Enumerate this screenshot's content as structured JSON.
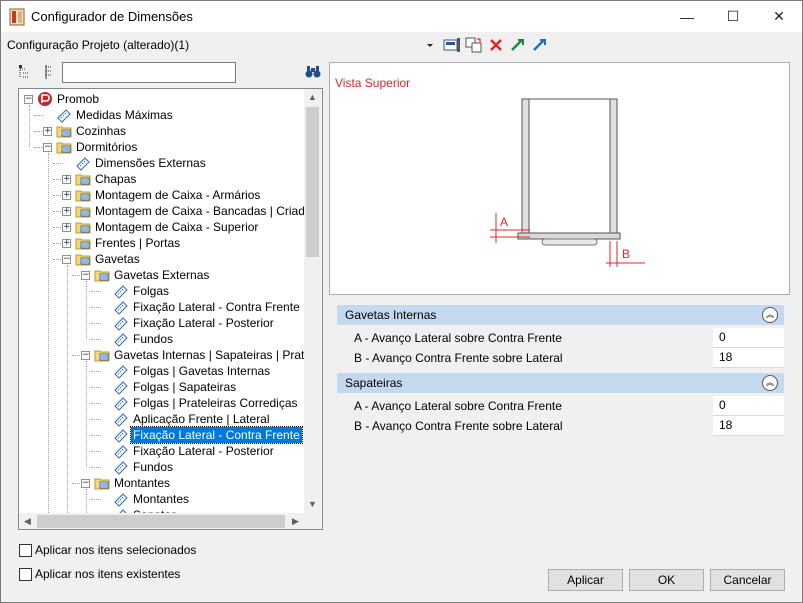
{
  "window": {
    "title": "Configurador de Dimensões",
    "minimize": "—",
    "maximize": "☐",
    "close": "✕"
  },
  "config_label": "Configuração Projeto (alterado)(1)",
  "search": {
    "value": "",
    "placeholder": ""
  },
  "tree": [
    {
      "label": "Promob",
      "selected": false
    },
    {
      "label": "Medidas Máximas",
      "selected": false
    },
    {
      "label": "Cozinhas",
      "selected": false
    },
    {
      "label": "Dormitórios",
      "selected": false
    },
    {
      "label": "Dimensões Externas",
      "selected": false
    },
    {
      "label": "Chapas",
      "selected": false
    },
    {
      "label": "Montagem de Caixa - Armários",
      "selected": false
    },
    {
      "label": "Montagem de Caixa - Bancadas | Criados",
      "selected": false
    },
    {
      "label": "Montagem de Caixa - Superior",
      "selected": false
    },
    {
      "label": "Frentes | Portas",
      "selected": false
    },
    {
      "label": "Gavetas",
      "selected": false
    },
    {
      "label": "Gavetas Externas",
      "selected": false
    },
    {
      "label": "Folgas",
      "selected": false
    },
    {
      "label": "Fixação Lateral - Contra Frente",
      "selected": false
    },
    {
      "label": "Fixação Lateral - Posterior",
      "selected": false
    },
    {
      "label": "Fundos",
      "selected": false
    },
    {
      "label": "Gavetas Internas | Sapateiras | Prat Cor",
      "selected": false
    },
    {
      "label": "Folgas | Gavetas Internas",
      "selected": false
    },
    {
      "label": "Folgas | Sapateiras",
      "selected": false
    },
    {
      "label": "Folgas | Prateleiras Corrediças",
      "selected": false
    },
    {
      "label": "Aplicação Frente | Lateral",
      "selected": false
    },
    {
      "label": "Fixação Lateral - Contra Frente",
      "selected": true
    },
    {
      "label": "Fixação Lateral - Posterior",
      "selected": false
    },
    {
      "label": "Fundos",
      "selected": false
    },
    {
      "label": "Montantes",
      "selected": false
    },
    {
      "label": "Montantes",
      "selected": false
    },
    {
      "label": "Sapatas",
      "selected": false
    }
  ],
  "preview": {
    "title": "Vista Superior",
    "label_a": "A",
    "label_b": "B"
  },
  "groups": [
    {
      "title": "Gavetas Internas",
      "rows": [
        {
          "name": "A - Avanço Lateral sobre Contra Frente",
          "value": "0"
        },
        {
          "name": "B - Avanço Contra Frente sobre Lateral",
          "value": "18"
        }
      ]
    },
    {
      "title": "Sapateiras",
      "rows": [
        {
          "name": "A - Avanço Lateral sobre Contra Frente",
          "value": "0"
        },
        {
          "name": "B - Avanço Contra Frente sobre Lateral",
          "value": "18"
        }
      ]
    }
  ],
  "options": {
    "apply_selected": "Aplicar nos itens selecionados",
    "apply_existing": "Aplicar nos itens existentes"
  },
  "buttons": {
    "apply": "Aplicar",
    "ok": "OK",
    "cancel": "Cancelar"
  },
  "colors": {
    "accent_red": "#e2242d",
    "selection": "#0078d7",
    "group_header": "#c5d9ee"
  }
}
